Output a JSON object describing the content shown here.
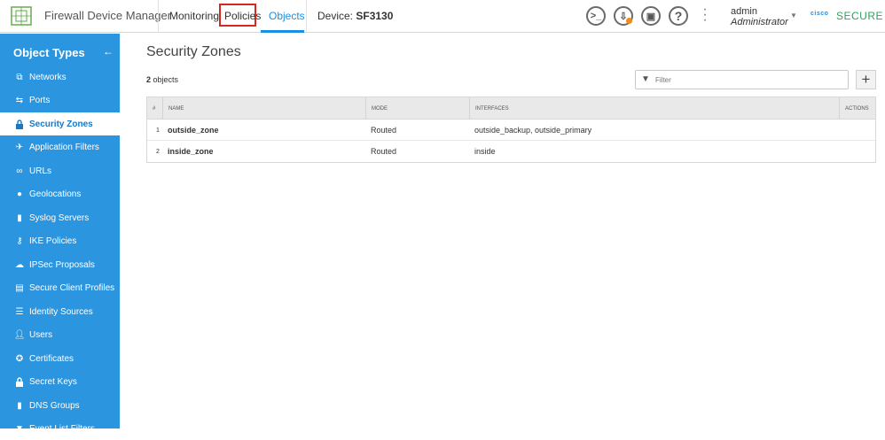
{
  "header": {
    "app_title": "Firewall Device Manager",
    "nav": [
      "Monitoring",
      "Policies",
      "Objects"
    ],
    "device_label": "Device:",
    "device_name": "SF3130",
    "help_glyph": "?",
    "user_name": "admin",
    "user_role": "Administrator",
    "brand_cisco": "cisco",
    "brand_secure": "SECURE"
  },
  "sidebar": {
    "title": "Object Types",
    "items": [
      {
        "label": "Networks",
        "icon": "networks-icon"
      },
      {
        "label": "Ports",
        "icon": "ports-icon"
      },
      {
        "label": "Security Zones",
        "icon": "lock-icon",
        "active": true
      },
      {
        "label": "Application Filters",
        "icon": "app-filter-icon"
      },
      {
        "label": "URLs",
        "icon": "link-icon"
      },
      {
        "label": "Geolocations",
        "icon": "map-pin-icon"
      },
      {
        "label": "Syslog Servers",
        "icon": "server-icon"
      },
      {
        "label": "IKE Policies",
        "icon": "key-icon"
      },
      {
        "label": "IPSec Proposals",
        "icon": "cloud-lock-icon"
      },
      {
        "label": "Secure Client Profiles",
        "icon": "document-icon"
      },
      {
        "label": "Identity Sources",
        "icon": "identity-icon"
      },
      {
        "label": "Users",
        "icon": "user-icon"
      },
      {
        "label": "Certificates",
        "icon": "certificate-icon"
      },
      {
        "label": "Secret Keys",
        "icon": "lock-icon"
      },
      {
        "label": "DNS Groups",
        "icon": "dns-icon"
      },
      {
        "label": "Event List Filters",
        "icon": "filter-icon"
      }
    ]
  },
  "main": {
    "title": "Security Zones",
    "count_number": "2",
    "count_label": "objects",
    "filter_placeholder": "Filter",
    "add_glyph": "+",
    "table": {
      "columns": [
        "#",
        "NAME",
        "MODE",
        "INTERFACES",
        "ACTIONS"
      ],
      "rows": [
        {
          "num": "1",
          "name": "outside_zone",
          "mode": "Routed",
          "interfaces": "outside_backup, outside_primary"
        },
        {
          "num": "2",
          "name": "inside_zone",
          "mode": "Routed",
          "interfaces": "inside"
        }
      ]
    }
  },
  "colors": {
    "sidebar_bg": "#2c95e0",
    "accent_blue": "#1b8fe0",
    "highlight_red": "#d22a1f",
    "secure_green": "#2ba35a",
    "deploy_dot": "#f28a1b"
  }
}
